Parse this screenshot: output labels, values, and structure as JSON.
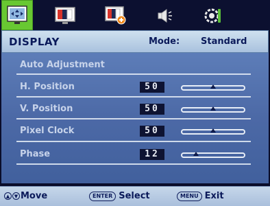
{
  "tabs": [
    {
      "icon": "display-settings-icon",
      "active": true
    },
    {
      "icon": "picture-icon",
      "active": false
    },
    {
      "icon": "picture-advanced-icon",
      "active": false
    },
    {
      "icon": "audio-icon",
      "active": false
    },
    {
      "icon": "system-settings-icon",
      "active": false
    }
  ],
  "header": {
    "title": "DISPLAY",
    "mode_label": "Mode:",
    "mode_value": "Standard"
  },
  "menu": {
    "auto_adjustment": "Auto Adjustment",
    "items": [
      {
        "label": "H. Position",
        "value": "50",
        "level": 0.5
      },
      {
        "label": "V. Position",
        "value": "50",
        "level": 0.5
      },
      {
        "label": "Pixel Clock",
        "value": "50",
        "level": 0.5
      },
      {
        "label": "Phase",
        "value": "12",
        "level": 0.22
      }
    ]
  },
  "footer": {
    "move_label": "Move",
    "enter_key": "ENTER",
    "select_label": "Select",
    "menu_key": "MENU",
    "exit_label": "Exit"
  },
  "colors": {
    "active_tab": "#68c832",
    "header_bg": "#bcd2e8",
    "panel_bg": "#4c69a6",
    "text_dark": "#0b1a5a"
  }
}
